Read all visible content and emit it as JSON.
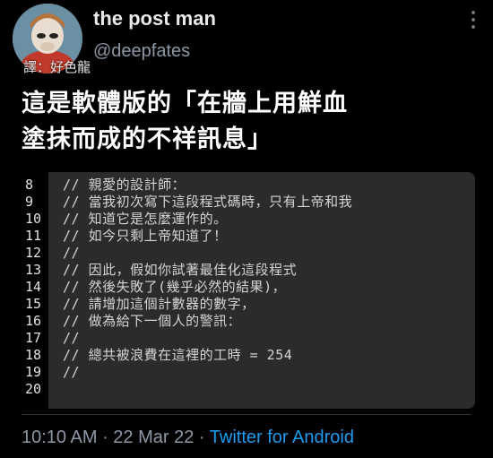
{
  "author": {
    "display_name": "the post man",
    "handle": "@deepfates",
    "translator_note": "譯：好色龍"
  },
  "tweet": {
    "text_line1": "這是軟體版的「在牆上用鮮血",
    "text_line2": "塗抹而成的不祥訊息」"
  },
  "code_block": {
    "lines": [
      {
        "no": "8",
        "text": "// 親愛的設計師："
      },
      {
        "no": "9",
        "text": "// 當我初次寫下這段程式碼時，只有上帝和我"
      },
      {
        "no": "10",
        "text": "// 知道它是怎麼運作的。"
      },
      {
        "no": "11",
        "text": "// 如今只剩上帝知道了！"
      },
      {
        "no": "12",
        "text": "//"
      },
      {
        "no": "13",
        "text": "// 因此，假如你試著最佳化這段程式"
      },
      {
        "no": "14",
        "text": "// 然後失敗了(幾乎必然的結果)，"
      },
      {
        "no": "15",
        "text": "// 請增加這個計數器的數字，"
      },
      {
        "no": "16",
        "text": "// 做為給下一個人的警訊："
      },
      {
        "no": "17",
        "text": "//"
      },
      {
        "no": "18",
        "text": "// 總共被浪費在這裡的工時 = 254"
      },
      {
        "no": "19",
        "text": "//"
      },
      {
        "no": "20",
        "text": ""
      }
    ]
  },
  "meta": {
    "time": "10:10 AM",
    "date": "22 Mar 22",
    "separator": " · ",
    "source": "Twitter for Android"
  },
  "icons": {
    "more": "more-vertical-icon"
  }
}
